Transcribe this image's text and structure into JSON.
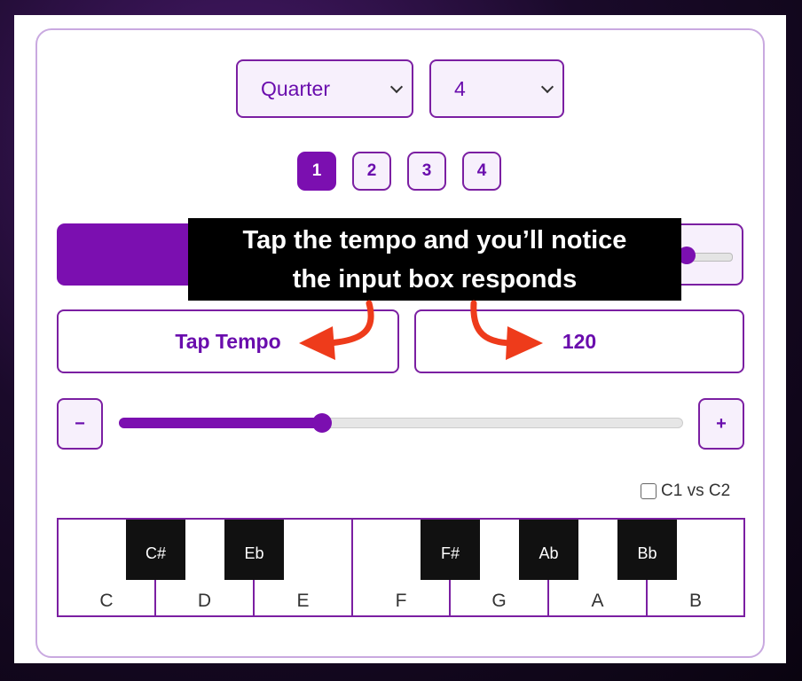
{
  "subdivision_select": {
    "value": "Quarter"
  },
  "beats_select": {
    "value": "4"
  },
  "beat_buttons": [
    {
      "label": "1",
      "active": true
    },
    {
      "label": "2",
      "active": false
    },
    {
      "label": "3",
      "active": false
    },
    {
      "label": "4",
      "active": false
    }
  ],
  "tap_tempo": {
    "label": "Tap Tempo"
  },
  "bpm_input": {
    "value": "120"
  },
  "tempo_slider": {
    "fill_fraction": 0.36
  },
  "stepper": {
    "minus": "−",
    "plus": "+"
  },
  "compare": {
    "label": "C1 vs C2",
    "checked": false
  },
  "piano": {
    "white_keys": [
      "C",
      "D",
      "E",
      "F",
      "G",
      "A",
      "B"
    ],
    "black_keys": [
      "C#",
      "Eb",
      "F#",
      "Ab",
      "Bb"
    ]
  },
  "callout": {
    "line1": "Tap the tempo and you’ll notice",
    "line2": "the input box responds"
  },
  "colors": {
    "accent": "#7b0fb0",
    "arrow": "#ee3b1b"
  }
}
